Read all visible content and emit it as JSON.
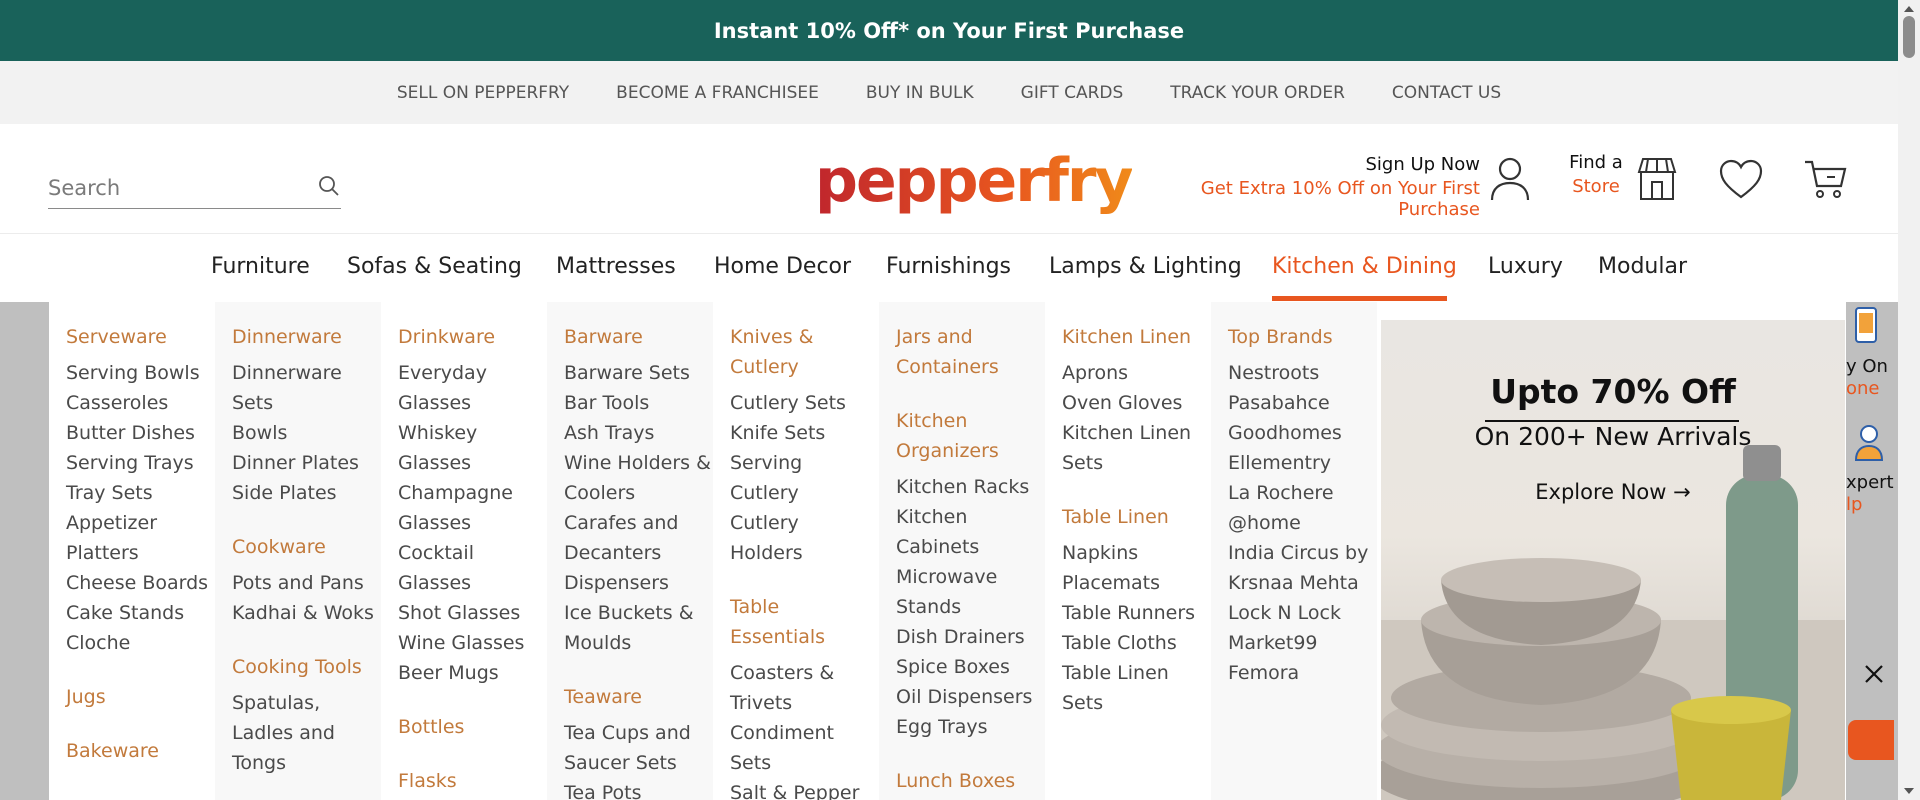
{
  "promo": {
    "text": "Instant 10% Off* on Your First Purchase"
  },
  "utility_links": [
    "SELL ON PEPPERFRY",
    "BECOME A FRANCHISEE",
    "BUY IN BULK",
    "GIFT CARDS",
    "TRACK YOUR ORDER",
    "CONTACT US"
  ],
  "header": {
    "search_placeholder": "Search",
    "logo": "pepperfry",
    "signup_title": "Sign Up Now",
    "signup_offer": "Get Extra 10% Off on Your First Purchase",
    "find_store_line1": "Find a",
    "find_store_line2": "Store"
  },
  "nav": {
    "items": [
      "Furniture",
      "Sofas & Seating",
      "Mattresses",
      "Home Decor",
      "Furnishings",
      "Lamps & Lighting",
      "Kitchen & Dining",
      "Luxury",
      "Modular"
    ],
    "active": "Kitchen & Dining"
  },
  "mega": {
    "c1": {
      "h1": "Serveware",
      "i1": [
        "Serving Bowls",
        "Casseroles",
        "Butter Dishes",
        "Serving Trays",
        "Tray Sets",
        "Appetizer",
        "Platters",
        "Cheese Boards",
        "Cake Stands",
        "Cloche"
      ],
      "h2": "Jugs",
      "h3": "Bakeware"
    },
    "c2": {
      "h1": "Dinnerware",
      "i1": [
        "Dinnerware",
        "Sets",
        "Bowls",
        "Dinner Plates",
        "Side Plates"
      ],
      "h2": "Cookware",
      "i2": [
        "Pots and Pans",
        "Kadhai & Woks"
      ],
      "h3": "Cooking Tools",
      "i3": [
        "Spatulas,",
        "Ladles and",
        "Tongs"
      ]
    },
    "c3": {
      "h1": "Drinkware",
      "i1": [
        "Everyday",
        "Glasses",
        "Whiskey",
        "Glasses",
        "Champagne",
        "Glasses",
        "Cocktail",
        "Glasses",
        "Shot Glasses",
        "Wine Glasses",
        "Beer Mugs"
      ],
      "h2": "Bottles",
      "h3": "Flasks"
    },
    "c4": {
      "h1": "Barware",
      "i1": [
        "Barware Sets",
        "Bar Tools",
        "Ash Trays",
        "Wine Holders &",
        "Coolers",
        "Carafes and",
        "Decanters",
        "Dispensers",
        "Ice Buckets &",
        "Moulds"
      ],
      "h2": "Teaware",
      "i2": [
        "Tea Cups and",
        "Saucer Sets",
        "Tea Pots"
      ]
    },
    "c5": {
      "h1a": "Knives &",
      "h1b": "Cutlery",
      "i1": [
        "Cutlery Sets",
        "Knife Sets",
        "Serving",
        "Cutlery",
        "Cutlery",
        "Holders"
      ],
      "h2a": "Table",
      "h2b": "Essentials",
      "i2": [
        "Coasters &",
        "Trivets",
        "Condiment",
        "Sets",
        "Salt & Pepper"
      ]
    },
    "c6": {
      "h1a": "Jars and",
      "h1b": "Containers",
      "h2a": "Kitchen",
      "h2b": "Organizers",
      "i2": [
        "Kitchen Racks",
        "Kitchen",
        "Cabinets",
        "Microwave",
        "Stands",
        "Dish Drainers",
        "Spice Boxes",
        "Oil Dispensers",
        "Egg Trays"
      ],
      "h3": "Lunch Boxes"
    },
    "c7": {
      "h1": "Kitchen Linen",
      "i1": [
        "Aprons",
        "Oven Gloves",
        "Kitchen Linen",
        "Sets"
      ],
      "h2": "Table Linen",
      "i2": [
        "Napkins",
        "Placemats",
        "Table Runners",
        "Table Cloths",
        "Table Linen",
        "Sets"
      ]
    },
    "c8": {
      "h1": "Top Brands",
      "i1": [
        "Nestroots",
        "Pasabahce",
        "Goodhomes",
        "Ellementry",
        "La Rochere",
        "@home",
        "India Circus by",
        "Krsnaa Mehta",
        "Lock N Lock",
        "Market99",
        "Femora"
      ]
    }
  },
  "banner": {
    "headline": "Upto 70% Off",
    "subline": "On 200+ New Arrivals",
    "cta": "Explore Now →"
  },
  "side_widget": {
    "label1a": "y On",
    "label1b": "one",
    "label2a": "xpert",
    "label2b": "lp"
  },
  "colors": {
    "promo_bg": "#19625a",
    "accent": "#e8561f",
    "category_heading": "#c27a3c"
  }
}
